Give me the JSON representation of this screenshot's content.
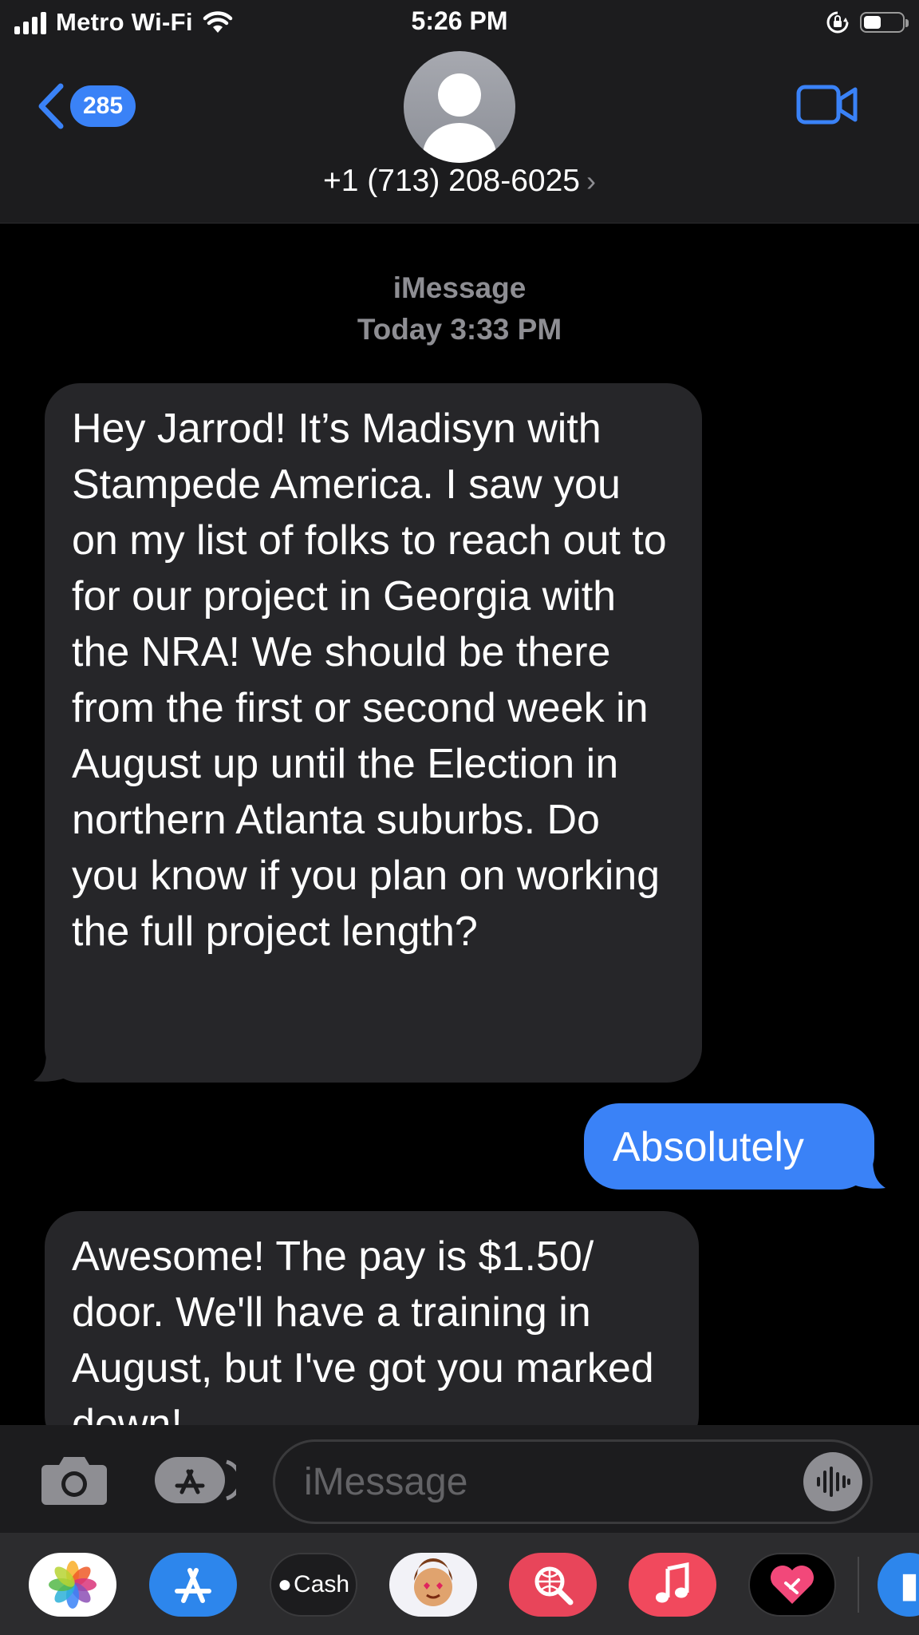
{
  "status_bar": {
    "carrier": "Metro Wi-Fi",
    "time": "5:26 PM",
    "battery_level": 0.45
  },
  "header": {
    "back_count": "285",
    "contact": "+1 (713) 208-6025",
    "icons": [
      "back-chevron-icon",
      "contact-avatar-icon",
      "video-call-icon"
    ]
  },
  "thread": {
    "service": "iMessage",
    "timestamp": "Today 3:33 PM",
    "messages": [
      {
        "direction": "received",
        "text": "Hey Jarrod! It’s Madisyn with Stampede America. I saw you on my list of folks to reach out to for our project in Georgia with the NRA! We should be there from the first or second week in August up until the Election in northern Atlanta suburbs. Do you know if you plan on working the full project length?"
      },
      {
        "direction": "sent",
        "text": "Absolutely"
      },
      {
        "direction": "received",
        "text": "Awesome! The pay is $1.50/ door. We'll have a training in August, but I've got you marked down!"
      }
    ]
  },
  "input_bar": {
    "placeholder": "iMessage",
    "value": ""
  },
  "app_drawer": {
    "apps": [
      "Photos",
      "App Store",
      "Cash",
      "Memoji",
      "Images",
      "Music",
      "Heart"
    ],
    "cash_label": "Cash"
  },
  "colors": {
    "accent_blue": "#3a82f7",
    "received_bubble": "#262629",
    "bar_background": "#1c1c1e"
  }
}
